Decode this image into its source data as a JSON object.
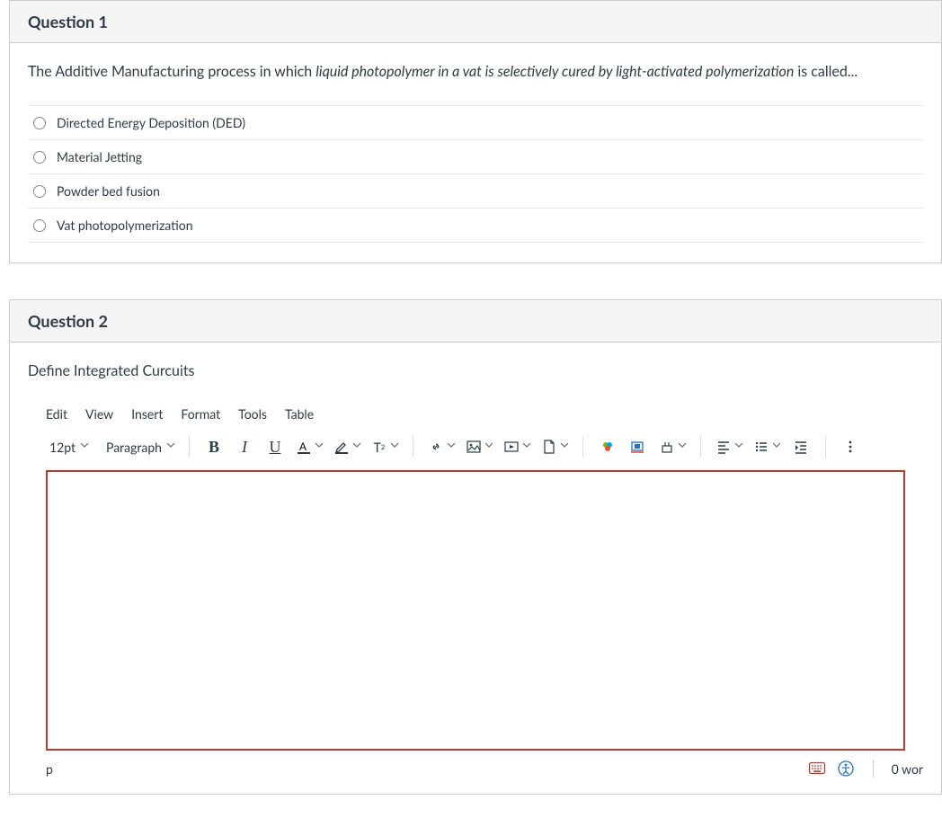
{
  "question1": {
    "title": "Question 1",
    "prompt_pre": "The Additive Manufacturing process in which ",
    "prompt_em": "liquid photopolymer in a vat is selectively cured by light-activated polymerization",
    "prompt_post": " is called...",
    "options": {
      "a": "Directed Energy Deposition (DED)",
      "b": "Material Jetting",
      "c": "Powder bed fusion",
      "d": "Vat photopolymerization"
    }
  },
  "question2": {
    "title": "Question 2",
    "prompt": "Define Integrated Curcuits",
    "menubar": {
      "edit": "Edit",
      "view": "View",
      "insert": "Insert",
      "format": "Format",
      "tools": "Tools",
      "table": "Table"
    },
    "toolbar": {
      "fontsize": "12pt",
      "blocktype": "Paragraph"
    },
    "status": {
      "path": "p",
      "wordcount": "0 wor"
    }
  }
}
